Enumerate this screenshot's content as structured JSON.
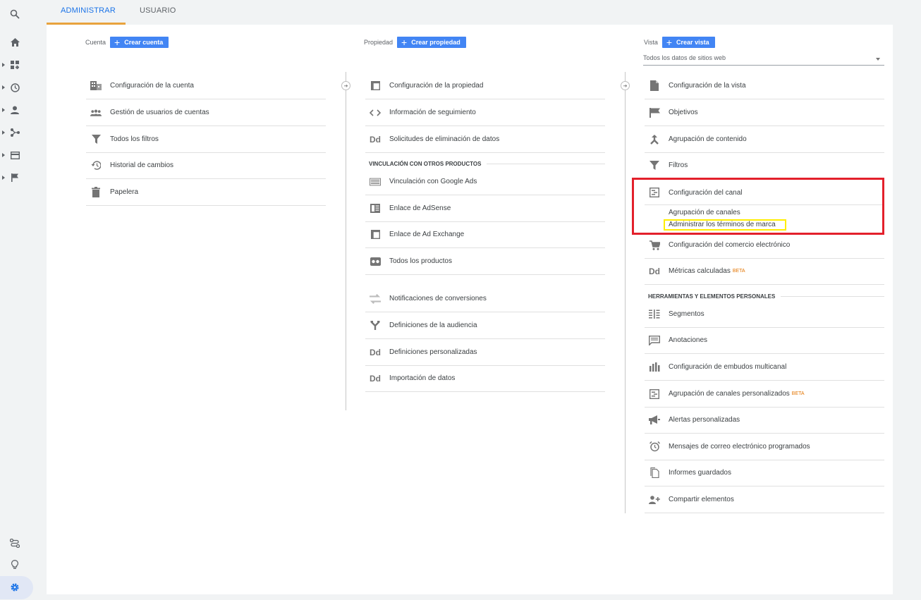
{
  "tabs": [
    {
      "label": "ADMINISTRAR",
      "active": true
    },
    {
      "label": "USUARIO",
      "active": false
    }
  ],
  "colors": {
    "accent": "#1a73e8",
    "button": "#4285f4",
    "tab_underline": "#e8a33d",
    "highlight_red": "#e3202b",
    "highlight_yellow": "#ffee00",
    "beta": "#e37400"
  },
  "rail_icons": [
    "search-icon",
    "home-icon",
    "dashboard-icon",
    "clock-icon",
    "person-icon",
    "share-icon",
    "card-icon",
    "flag-icon",
    "route-icon",
    "lightbulb-icon",
    "gear-icon"
  ],
  "account": {
    "label": "Cuenta",
    "create_label": "Crear cuenta",
    "items": [
      {
        "label": "Configuración de la cuenta",
        "icon": "building-icon"
      },
      {
        "label": "Gestión de usuarios de cuentas",
        "icon": "people-icon"
      },
      {
        "label": "Todos los filtros",
        "icon": "filter-icon"
      },
      {
        "label": "Historial de cambios",
        "icon": "history-icon"
      },
      {
        "label": "Papelera",
        "icon": "trash-icon"
      }
    ]
  },
  "property": {
    "label": "Propiedad",
    "create_label": "Crear propiedad",
    "items": [
      {
        "label": "Configuración de la propiedad",
        "icon": "window-icon"
      },
      {
        "label": "Información de seguimiento",
        "icon": "code-icon"
      },
      {
        "label": "Solicitudes de eliminación de datos",
        "icon": "dd-icon"
      }
    ],
    "linking_section": "VINCULACIÓN CON OTROS PRODUCTOS",
    "linking_items": [
      {
        "label": "Vinculación con Google Ads",
        "icon": "ads-icon"
      },
      {
        "label": "Enlace de AdSense",
        "icon": "adsense-icon"
      },
      {
        "label": "Enlace de Ad Exchange",
        "icon": "window-icon"
      },
      {
        "label": "Todos los productos",
        "icon": "products-icon"
      }
    ],
    "other_items": [
      {
        "label": "Notificaciones de conversiones",
        "icon": "swap-icon"
      },
      {
        "label": "Definiciones de la audiencia",
        "icon": "fork-icon"
      },
      {
        "label": "Definiciones personalizadas",
        "icon": "dd-icon"
      },
      {
        "label": "Importación de datos",
        "icon": "dd-icon"
      }
    ]
  },
  "view": {
    "label": "Vista",
    "create_label": "Crear vista",
    "selected": "Todos los datos de sitios web",
    "items": [
      {
        "label": "Configuración de la vista",
        "icon": "document-icon"
      },
      {
        "label": "Objetivos",
        "icon": "flag-icon"
      },
      {
        "label": "Agrupación de contenido",
        "icon": "merge-icon"
      },
      {
        "label": "Filtros",
        "icon": "filter-icon"
      }
    ],
    "channel": {
      "label": "Configuración del canal",
      "sub_items": [
        "Agrupación de canales",
        "Administrar los términos de marca"
      ]
    },
    "more_items": [
      {
        "label": "Configuración del comercio electrónico",
        "icon": "cart-icon"
      },
      {
        "label": "Métricas calculadas",
        "icon": "dd-icon",
        "badge": "BETA"
      }
    ],
    "tools_section": "HERRAMIENTAS Y ELEMENTOS PERSONALES",
    "tools_items": [
      {
        "label": "Segmentos",
        "icon": "segments-icon"
      },
      {
        "label": "Anotaciones",
        "icon": "comment-icon"
      },
      {
        "label": "Configuración de embudos multicanal",
        "icon": "bar-chart-icon"
      },
      {
        "label": "Agrupación de canales personalizados",
        "icon": "channel-icon",
        "badge": "BETA"
      },
      {
        "label": "Alertas personalizadas",
        "icon": "megaphone-icon"
      },
      {
        "label": "Mensajes de correo electrónico programados",
        "icon": "alarm-icon"
      },
      {
        "label": "Informes guardados",
        "icon": "saved-report-icon"
      },
      {
        "label": "Compartir elementos",
        "icon": "person-add-icon"
      }
    ]
  }
}
